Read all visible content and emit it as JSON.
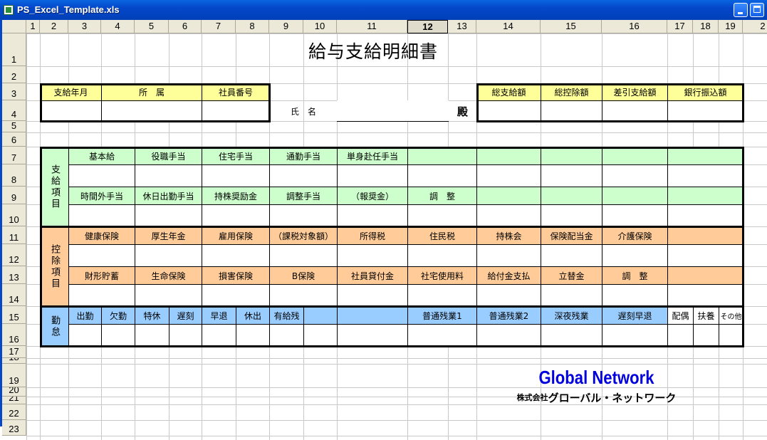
{
  "window": {
    "title": "PS_Excel_Template.xls",
    "app_icon": "excel-icon",
    "buttons": [
      "minimize",
      "maximize"
    ]
  },
  "sheet": {
    "column_headers": [
      "1",
      "2",
      "3",
      "4",
      "5",
      "6",
      "7",
      "8",
      "9",
      "10",
      "11",
      "12",
      "13",
      "14",
      "15",
      "16",
      "17",
      "18",
      "19",
      "2"
    ],
    "selected_column": "12",
    "row_headers": [
      "1",
      "2",
      "3",
      "4",
      "5",
      "6",
      "7",
      "8",
      "9",
      "10",
      "11",
      "12",
      "13",
      "14",
      "15",
      "16",
      "17",
      "18",
      "19",
      "20",
      "21",
      "22",
      "23"
    ]
  },
  "form": {
    "title": "給与支給明細書",
    "info_headers": [
      "支給年月",
      "所　属",
      "社員番号"
    ],
    "name_label": "氏　名",
    "honorific": "殿",
    "total_headers": [
      "総支給額",
      "総控除額",
      "差引支給額",
      "銀行振込額"
    ],
    "payments": {
      "section_label": "支給項目",
      "row1": [
        "基本給",
        "役職手当",
        "住宅手当",
        "通勤手当",
        "単身赴任手当",
        "",
        "",
        "",
        "",
        ""
      ],
      "row2": [
        "時間外手当",
        "休日出勤手当",
        "持株奨励金",
        "調整手当",
        "（報奨金）",
        "調　整",
        "",
        "",
        "",
        ""
      ]
    },
    "deductions": {
      "section_label": "控除項目",
      "row1": [
        "健康保険",
        "厚生年金",
        "雇用保険",
        "（課税対象額）",
        "所得税",
        "住民税",
        "持株会",
        "保険配当金",
        "介護保険",
        ""
      ],
      "row2": [
        "財形貯蓄",
        "生命保険",
        "損害保険",
        "B保険",
        "社員貸付金",
        "社宅使用料",
        "給付金支払",
        "立替金",
        "調　整",
        ""
      ]
    },
    "attendance": {
      "section_label": "勤怠",
      "items": [
        "出勤",
        "欠勤",
        "特休",
        "遅刻",
        "早退",
        "休出",
        "有給残",
        "",
        "",
        "普通残業1",
        "普通残業2",
        "深夜残業",
        "遅刻早退",
        "配偶",
        "扶養",
        "その他"
      ]
    }
  },
  "logo": {
    "english": "Global Network",
    "japanese_prefix": "株式会社",
    "japanese_name": "グローバル・ネットワーク"
  },
  "colors": {
    "yellow": "#FFFF99",
    "green": "#CCFFCC",
    "orange": "#FFCC99",
    "blue": "#99CCFF",
    "logo_blue": "#0000DD"
  }
}
